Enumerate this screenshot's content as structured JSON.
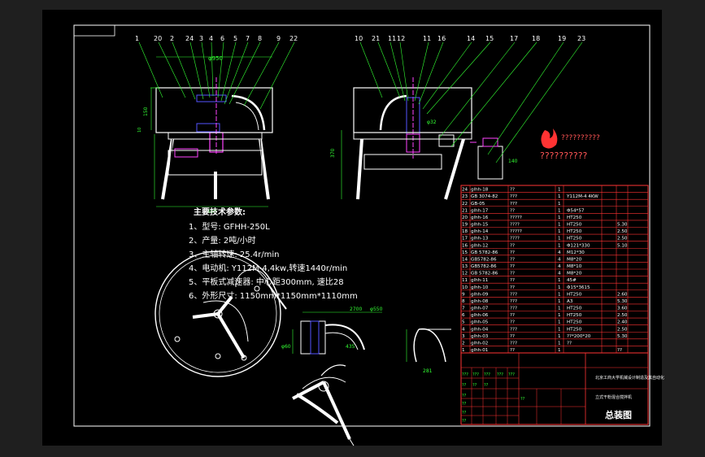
{
  "colors": {
    "background": "#000000",
    "frame": "#ffffff",
    "leader_lines": "#33ff33",
    "table_lines": "#ff3333",
    "parts": "#ffffff",
    "hatch": "#4444ff",
    "accent": "#ff00ff"
  },
  "balloons_left": [
    "1",
    "20",
    "2",
    "24",
    "3",
    "4",
    "6",
    "5",
    "7",
    "8",
    "9",
    "22"
  ],
  "balloons_right": [
    "10",
    "21",
    "11",
    "12",
    "11",
    "16",
    "14",
    "15",
    "17",
    "18",
    "19",
    "23"
  ],
  "dimensions": {
    "top_width": "φ950",
    "height_a": "150",
    "height_b": "10",
    "base_width": "600",
    "side_height": "370",
    "shaft_dia": "φ32",
    "motor_dim": "140",
    "detail_a": "2700",
    "detail_b": "φ550",
    "detail_c": "435",
    "detail_d": "281",
    "detail_e": "φ60"
  },
  "specs": {
    "title": "主要技术参数:",
    "items": [
      "1、型号: GFHH-250L",
      "2、产量: 2吨/小时",
      "3、主轴转速: 25.4r/min",
      "4、电动机: Y112M-4,4kw,转速1440r/min",
      "5、平板式减速器: 中心距300mm, 速比28",
      "6、外形尺寸: 1150mm*1150mm*1110mm"
    ]
  },
  "logo_text": "??????????",
  "logo_text2": "??????????",
  "bom": [
    {
      "no": "24",
      "code": "glhh-18",
      "name": "??",
      "qty": "1",
      "mat": "",
      "note": ""
    },
    {
      "no": "23",
      "code": "GB 3074-82",
      "name": "???",
      "qty": "1",
      "mat": "Y112M-4 4KW",
      "note": ""
    },
    {
      "no": "22",
      "code": "GB-05",
      "name": "???",
      "qty": "1",
      "mat": "",
      "note": ""
    },
    {
      "no": "21",
      "code": "glhh-17",
      "name": "??",
      "qty": "1",
      "mat": "Φ54*57",
      "note": ""
    },
    {
      "no": "20",
      "code": "glhh-16",
      "name": "?????",
      "qty": "1",
      "mat": "HT250",
      "note": ""
    },
    {
      "no": "19",
      "code": "glhh-15",
      "name": "????",
      "qty": "1",
      "mat": "HT250",
      "note": "5.30"
    },
    {
      "no": "18",
      "code": "glhh-14",
      "name": "?????",
      "qty": "1",
      "mat": "HT250",
      "note": "2.50"
    },
    {
      "no": "17",
      "code": "glhh-13",
      "name": "????",
      "qty": "1",
      "mat": "HT250",
      "note": "2.50"
    },
    {
      "no": "16",
      "code": "glhh-12",
      "name": "??",
      "qty": "1",
      "mat": "Φ121*330",
      "note": "5.10"
    },
    {
      "no": "15",
      "code": "GB 5782-86",
      "name": "??",
      "qty": "4",
      "mat": "M12*30",
      "note": ""
    },
    {
      "no": "14",
      "code": "GB5782-86",
      "name": "??",
      "qty": "4",
      "mat": "M8*20",
      "note": ""
    },
    {
      "no": "13",
      "code": "GB5782-86",
      "name": "??",
      "qty": "4",
      "mat": "M8*10",
      "note": ""
    },
    {
      "no": "12",
      "code": "GB 5782-86",
      "name": "??",
      "qty": "4",
      "mat": "M8*20",
      "note": ""
    },
    {
      "no": "11",
      "code": "glhh-11",
      "name": "??",
      "qty": "1",
      "mat": "45#",
      "note": ""
    },
    {
      "no": "10",
      "code": "glhh-10",
      "name": "??",
      "qty": "1",
      "mat": "Φ15*3615",
      "note": ""
    },
    {
      "no": "9",
      "code": "glhh-09",
      "name": "???",
      "qty": "1",
      "mat": "HT250",
      "note": "2.60"
    },
    {
      "no": "8",
      "code": "glhh-08",
      "name": "???",
      "qty": "1",
      "mat": "A3",
      "note": "5.30"
    },
    {
      "no": "7",
      "code": "glhh-07",
      "name": "???",
      "qty": "1",
      "mat": "HT250",
      "note": "3.60"
    },
    {
      "no": "6",
      "code": "glhh-06",
      "name": "??",
      "qty": "1",
      "mat": "HT250",
      "note": "2.50"
    },
    {
      "no": "5",
      "code": "glhh-05",
      "name": "??",
      "qty": "1",
      "mat": "HT250",
      "note": "2.40"
    },
    {
      "no": "4",
      "code": "glhh-04",
      "name": "???",
      "qty": "1",
      "mat": "HT250",
      "note": "2.50"
    },
    {
      "no": "3",
      "code": "glhh-03",
      "name": "??",
      "qty": "1",
      "mat": "??*200*20",
      "note": "5.30"
    },
    {
      "no": "2",
      "code": "glhh-02",
      "name": "???",
      "qty": "1",
      "mat": "??",
      "note": ""
    },
    {
      "no": "1",
      "code": "glhh-01",
      "name": "??",
      "qty": "1",
      "mat": "",
      "note": "??"
    }
  ],
  "title_block": {
    "school": "北京工商大学机械设计制造及其自动化",
    "drawing_name": "立式干粉混合搅拌机",
    "main_title": "总装图",
    "small_labels": [
      "???",
      "???",
      "???",
      "???",
      "???",
      "??",
      "??",
      "??",
      "??",
      "??",
      "??",
      "??",
      "??"
    ]
  }
}
